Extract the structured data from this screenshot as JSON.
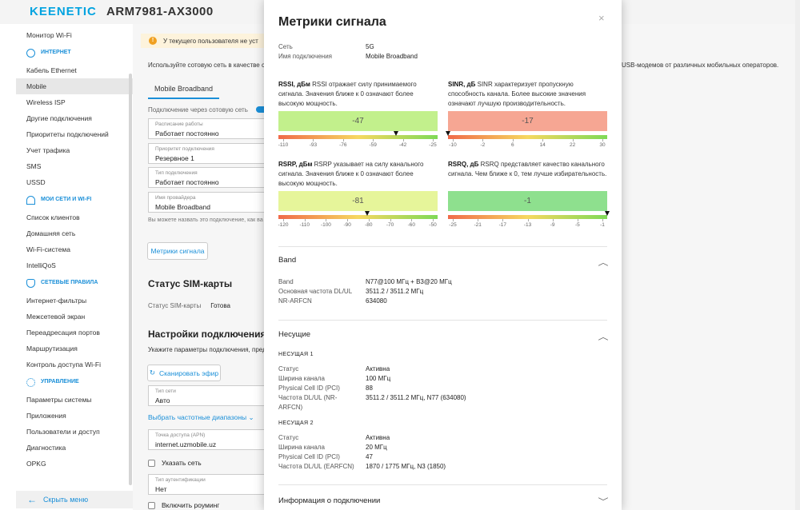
{
  "header": {
    "logo": "KEENETIC",
    "model": "ARM7981-AX3000"
  },
  "sidebar": {
    "items_top": [
      "Монитор Wi-Fi"
    ],
    "sec_internet": "ИНТЕРНЕТ",
    "internet_items": [
      "Кабель Ethernet",
      "Mobile",
      "Wireless ISP",
      "Другие подключения",
      "Приоритеты подключений",
      "Учет трафика",
      "SMS",
      "USSD"
    ],
    "sec_mynet": "МОИ СЕТИ И WI-FI",
    "mynet_items": [
      "Список клиентов",
      "Домашняя сеть",
      "Wi-Fi-система",
      "IntelliQoS"
    ],
    "sec_rules": "СЕТЕВЫЕ ПРАВИЛА",
    "rules_items": [
      "Интернет-фильтры",
      "Межсетевой экран",
      "Переадресация портов",
      "Маршрутизация",
      "Контроль доступа Wi-Fi"
    ],
    "sec_manage": "УПРАВЛЕНИЕ",
    "manage_items": [
      "Параметры системы",
      "Приложения",
      "Пользователи и доступ",
      "Диагностика",
      "OPKG"
    ],
    "collapse": "Скрыть меню"
  },
  "page": {
    "warning": "У текущего пользователя не уст",
    "intro": "Используйте сотовую сеть в качестве с",
    "intro_right": "USB-модемов от различных мобильных операторов.",
    "tab": "Mobile Broadband",
    "conn_toggle": "Подключение через сотовую сеть",
    "fields": [
      {
        "label": "Расписание работы",
        "value": "Работает постоянно"
      },
      {
        "label": "Приоритет подключения",
        "value": "Резервное 1"
      },
      {
        "label": "Тип подключения",
        "value": "Работает постоянно"
      },
      {
        "label": "Имя провайдера",
        "value": "Mobile Broadband"
      }
    ],
    "hint": "Вы можете назвать это подключение, как ва",
    "metrics_button": "Метрики сигнала",
    "sim_title": "Статус SIM-карты",
    "sim_label": "Статус SIM-карты",
    "sim_value": "Готова",
    "settings_title": "Настройки подключения",
    "settings_sub": "Укажите параметры подключения, пред",
    "scan_button": "Сканировать эфир",
    "net_type": {
      "label": "Тип сети",
      "value": "Авто"
    },
    "freq_link": "Выбрать частотные диапазоны",
    "apn": {
      "label": "Точка доступа (APN)",
      "value": "internet.uzmobile.uz"
    },
    "specify_network": "Указать сеть",
    "auth": {
      "label": "Тип аутентификации",
      "value": "Нет"
    },
    "roaming": "Включить роуминг"
  },
  "modal": {
    "title": "Метрики сигнала",
    "close": "×",
    "info": [
      {
        "k": "Сеть",
        "v": "5G"
      },
      {
        "k": "Имя подключения",
        "v": "Mobile Broadband"
      }
    ],
    "rssi": {
      "name": "RSSI, дБм",
      "desc": " RSSI отражает силу принимаемого сигнала. Значения ближе к 0 означают более высокую мощность.",
      "value": "-47",
      "color": "#c2f08c",
      "ticks": [
        "-110",
        "-93",
        "-76",
        "-59",
        "-42",
        "-25"
      ],
      "min": -110,
      "max": -25,
      "level": -47
    },
    "sinr": {
      "name": "SINR, дБ",
      "desc": " SINR характеризует пропускную способность канала. Более высокие значения означают лучшую производительность.",
      "value": "-17",
      "color": "#f6a693",
      "ticks": [
        "-10",
        "-2",
        "6",
        "14",
        "22",
        "30"
      ],
      "min": -10,
      "max": 30,
      "level": -10
    },
    "rsrp": {
      "name": "RSRP, дБм",
      "desc": " RSRP указывает на силу канального сигнала. Значения ближе к 0 означают более высокую мощность.",
      "value": "-81",
      "color": "#e6f59a",
      "ticks": [
        "-120",
        "-110",
        "-100",
        "-90",
        "-80",
        "-70",
        "-60",
        "-50"
      ],
      "min": -120,
      "max": -50,
      "level": -81
    },
    "rsrq": {
      "name": "RSRQ, дБ",
      "desc": " RSRQ представляет качество канального сигнала. Чем ближе к 0, тем лучше избирательность.",
      "value": "-1",
      "color": "#8ee08e",
      "ticks": [
        "-25",
        "-21",
        "-17",
        "-13",
        "-9",
        "-5",
        "-1"
      ],
      "min": -25,
      "max": -1,
      "level": -1
    },
    "band_title": "Band",
    "band": [
      {
        "k": "Band",
        "v": "N77@100 МГц + B3@20 МГц"
      },
      {
        "k": "Основная частота DL/UL",
        "v": "3511.2 / 3511.2 МГц"
      },
      {
        "k": "NR-ARFCN",
        "v": "634080"
      }
    ],
    "carriers_title": "Несущие",
    "carrier1_head": "НЕСУЩАЯ 1",
    "carrier1": [
      {
        "k": "Статус",
        "v": "Активна"
      },
      {
        "k": "Ширина канала",
        "v": "100 МГц"
      },
      {
        "k": "Physical Cell ID (PCI)",
        "v": "88"
      },
      {
        "k": "Частота DL/UL (NR-",
        "v": "3511.2 / 3511.2 МГц, N77 (634080)"
      },
      {
        "k": "ARFCN)",
        "v": ""
      }
    ],
    "carrier2_head": "НЕСУЩАЯ 2",
    "carrier2": [
      {
        "k": "Статус",
        "v": "Активна"
      },
      {
        "k": "Ширина канала",
        "v": "20 МГц"
      },
      {
        "k": "Physical Cell ID (PCI)",
        "v": "47"
      },
      {
        "k": "Частота DL/UL (EARFCN)",
        "v": "1870 / 1775 МГц, N3 (1850)"
      }
    ],
    "conn_info_title": "Информация о подключении"
  }
}
